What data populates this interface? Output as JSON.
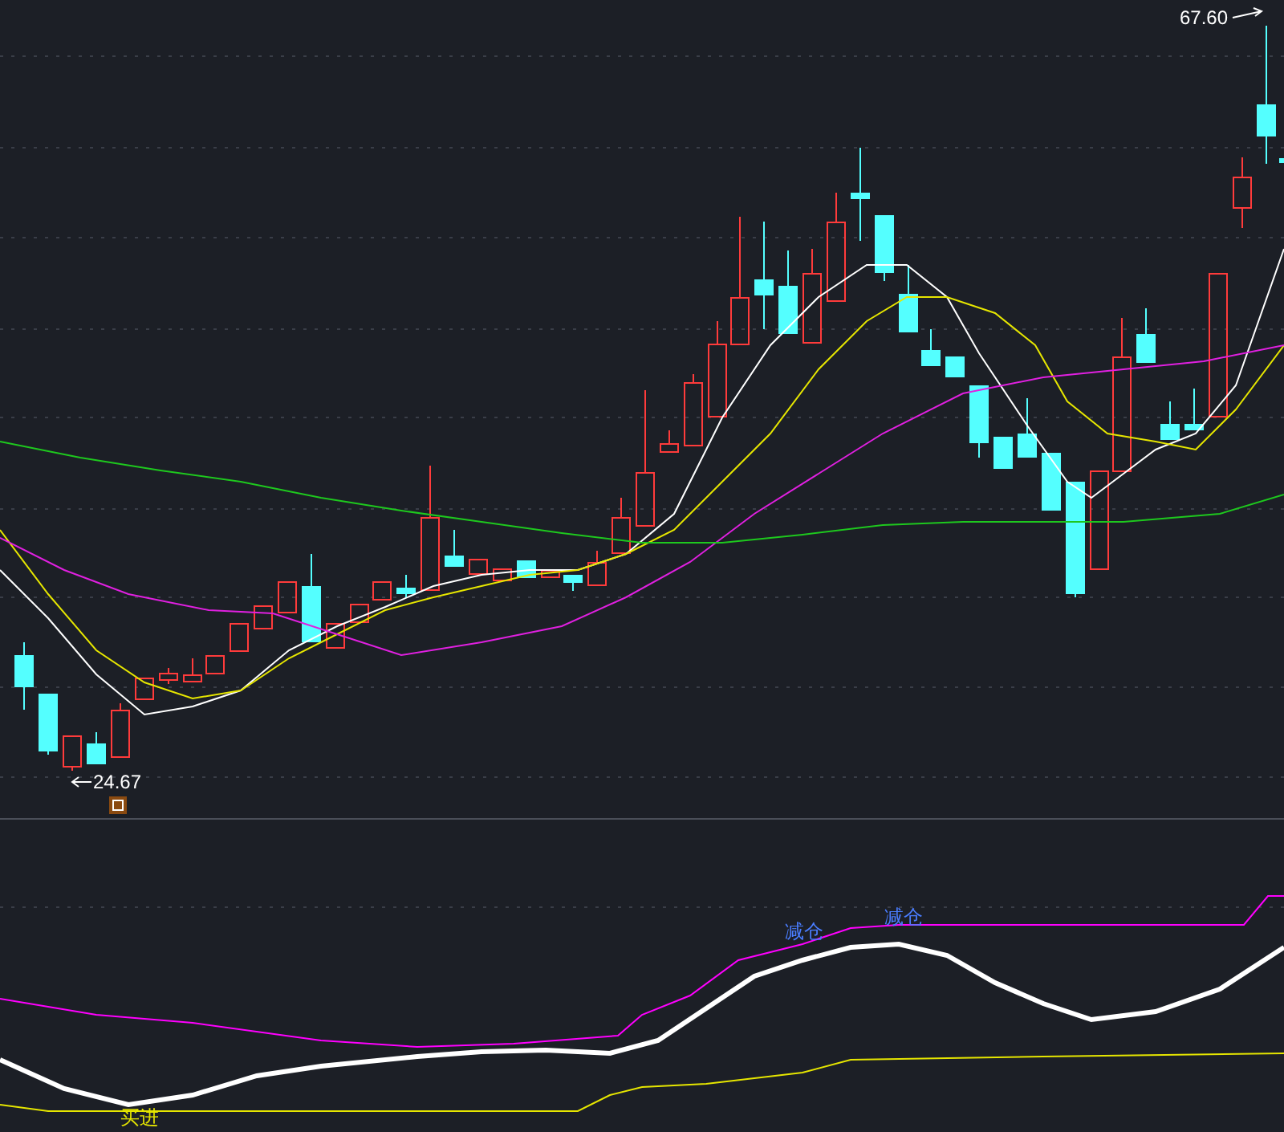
{
  "price_chart": {
    "high_label": "67.60",
    "low_label": "24.67"
  },
  "indicator_chart": {
    "signals": [
      {
        "kind": "sell",
        "text": "减仓"
      },
      {
        "kind": "sell",
        "text": "减仓"
      },
      {
        "kind": "buy",
        "text": "买进"
      }
    ]
  }
}
